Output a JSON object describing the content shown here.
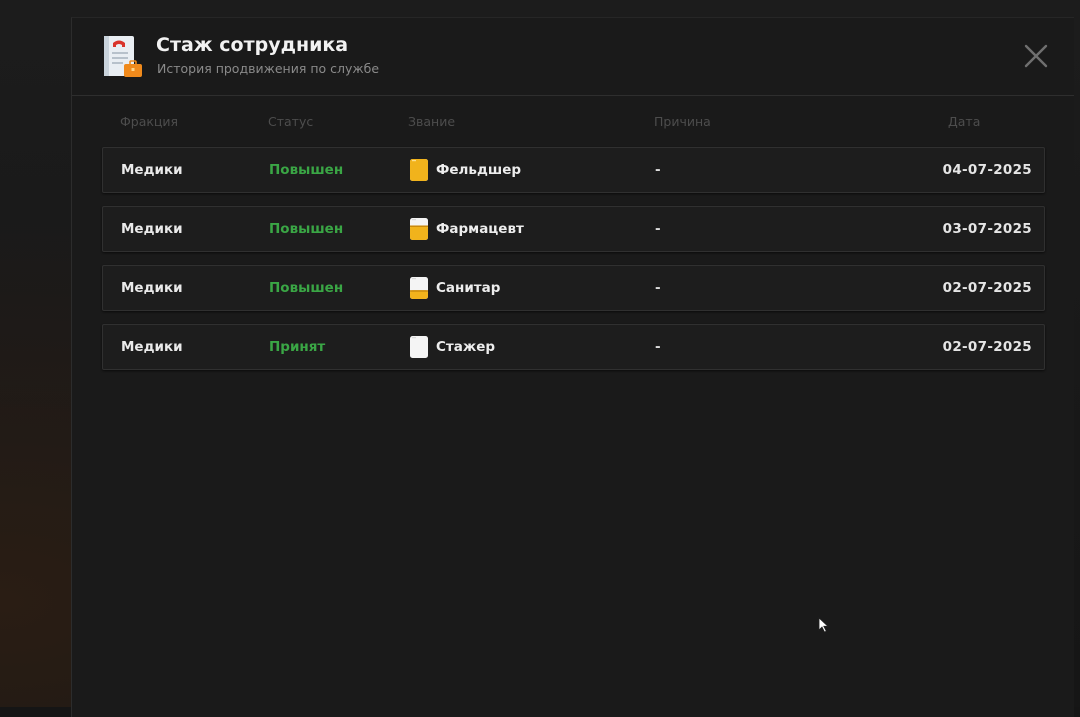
{
  "modal": {
    "title": "Стаж сотрудника",
    "subtitle": "История продвижения по службе",
    "icon": "employee-record-icon",
    "close_icon": "close-icon"
  },
  "columns": {
    "faction": "Фракция",
    "status": "Статус",
    "rank": "Звание",
    "reason": "Причина",
    "date": "Дата"
  },
  "rows": [
    {
      "faction": "Медики",
      "status": "Повышен",
      "rank": "Фельдшер",
      "rank_icon_fill": 1.0,
      "reason": "-",
      "date": "04-07-2025"
    },
    {
      "faction": "Медики",
      "status": "Повышен",
      "rank": "Фармацевт",
      "rank_icon_fill": 0.66,
      "reason": "-",
      "date": "03-07-2025"
    },
    {
      "faction": "Медики",
      "status": "Повышен",
      "rank": "Санитар",
      "rank_icon_fill": 0.4,
      "reason": "-",
      "date": "02-07-2025"
    },
    {
      "faction": "Медики",
      "status": "Принят",
      "rank": "Стажер",
      "rank_icon_fill": 0.0,
      "reason": "-",
      "date": "02-07-2025"
    }
  ],
  "colors": {
    "status_green": "#3aa645",
    "rank_icon_gold": "#f1b31c",
    "rank_icon_white": "#f4f4f4"
  }
}
